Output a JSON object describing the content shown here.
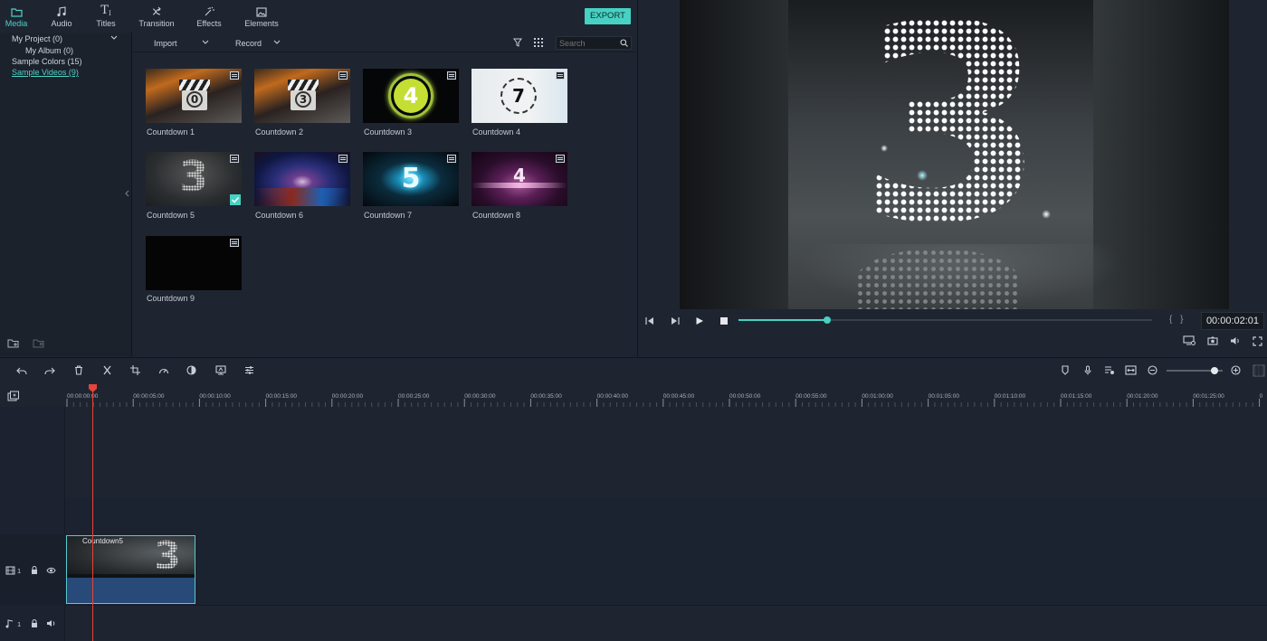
{
  "tabs": [
    {
      "label": "Media",
      "icon": "folder-icon",
      "active": true
    },
    {
      "label": "Audio",
      "icon": "music-note-icon"
    },
    {
      "label": "Titles",
      "icon": "text-icon"
    },
    {
      "label": "Transition",
      "icon": "transition-icon"
    },
    {
      "label": "Effects",
      "icon": "effects-icon"
    },
    {
      "label": "Elements",
      "icon": "image-icon"
    }
  ],
  "export_label": "EXPORT",
  "tree": {
    "items": [
      {
        "label": "My Project (0)"
      },
      {
        "label": "My Album (0)"
      },
      {
        "label": "Sample Colors (15)"
      },
      {
        "label": "Sample Videos (9)",
        "selected": true
      }
    ]
  },
  "media_toolbar": {
    "import_label": "Import",
    "record_label": "Record",
    "search_placeholder": "Search"
  },
  "media": [
    {
      "label": "Countdown 1"
    },
    {
      "label": "Countdown 2"
    },
    {
      "label": "Countdown 3"
    },
    {
      "label": "Countdown 4"
    },
    {
      "label": "Countdown 5",
      "checked": true
    },
    {
      "label": "Countdown 6"
    },
    {
      "label": "Countdown 7"
    },
    {
      "label": "Countdown 8"
    },
    {
      "label": "Countdown 9"
    }
  ],
  "preview": {
    "timecode": "00:00:02:01",
    "progress": 0.215,
    "screen_digit": "3",
    "in_out_label": "{ }"
  },
  "timeline": {
    "ruler": [
      "00:00:00:00",
      "00:00:05:00",
      "00:00:10:00",
      "00:00:15:00",
      "00:00:20:00",
      "00:00:25:00",
      "00:00:30:00",
      "00:00:35:00",
      "00:00:40:00",
      "00:00:45:00",
      "00:00:50:00",
      "00:00:55:00",
      "00:01:00:00",
      "00:01:05:00",
      "00:01:10:00",
      "00:01:15:00",
      "00:01:20:00",
      "00:01:25:00",
      "0"
    ],
    "zoom_level": 0.85,
    "video_track_label": "1",
    "audio_track_label": "1",
    "clip": {
      "label": "Countdown5",
      "digit": "3"
    }
  },
  "colors": {
    "accent": "#47d1c2",
    "playhead": "#e8433a",
    "clip_border": "#58c9cf",
    "clip_fill": "#274a78"
  }
}
